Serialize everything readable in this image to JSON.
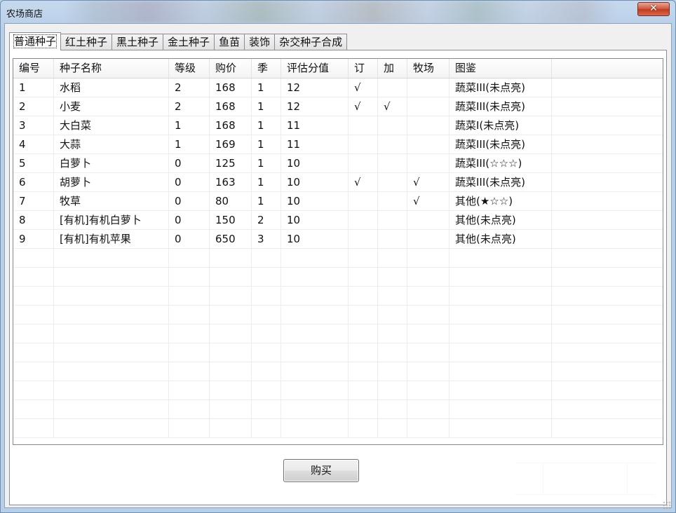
{
  "window": {
    "title": "农场商店",
    "close_label": "✕"
  },
  "tabs": [
    {
      "label": "普通种子",
      "active": true
    },
    {
      "label": "红土种子",
      "active": false
    },
    {
      "label": "黑土种子",
      "active": false
    },
    {
      "label": "金土种子",
      "active": false
    },
    {
      "label": "鱼苗",
      "active": false
    },
    {
      "label": "装饰",
      "active": false
    },
    {
      "label": "杂交种子合成",
      "active": false
    }
  ],
  "table": {
    "columns": [
      "编号",
      "种子名称",
      "等级",
      "购价",
      "季",
      "评估分值",
      "订",
      "加",
      "牧场",
      "图鉴",
      ""
    ],
    "rows": [
      [
        "1",
        "水稻",
        "2",
        "168",
        "1",
        "12",
        "√",
        "",
        "",
        "蔬菜III(未点亮)"
      ],
      [
        "2",
        "小麦",
        "2",
        "168",
        "1",
        "12",
        "√",
        "√",
        "",
        "蔬菜III(未点亮)"
      ],
      [
        "3",
        "大白菜",
        "1",
        "168",
        "1",
        "11",
        "",
        "",
        "",
        "蔬菜Ⅰ(未点亮)"
      ],
      [
        "4",
        "大蒜",
        "1",
        "169",
        "1",
        "11",
        "",
        "",
        "",
        "蔬菜III(未点亮)"
      ],
      [
        "5",
        "白萝卜",
        "0",
        "125",
        "1",
        "10",
        "",
        "",
        "",
        "蔬菜III(☆☆☆)"
      ],
      [
        "6",
        "胡萝卜",
        "0",
        "163",
        "1",
        "10",
        "√",
        "",
        "√",
        "蔬菜III(未点亮)"
      ],
      [
        "7",
        "牧草",
        "0",
        "80",
        "1",
        "10",
        "",
        "",
        "√",
        "其他(★☆☆)"
      ],
      [
        "8",
        "[有机]有机白萝卜",
        "0",
        "150",
        "2",
        "10",
        "",
        "",
        "",
        "其他(未点亮)"
      ],
      [
        "9",
        "[有机]有机苹果",
        "0",
        "650",
        "3",
        "10",
        "",
        "",
        "",
        "其他(未点亮)"
      ]
    ]
  },
  "buttons": {
    "buy_label": "购买"
  },
  "colors": {
    "window_frame": "#b9cfe8",
    "close_button": "#c03b1f",
    "client_background": "#f0f0f0"
  }
}
